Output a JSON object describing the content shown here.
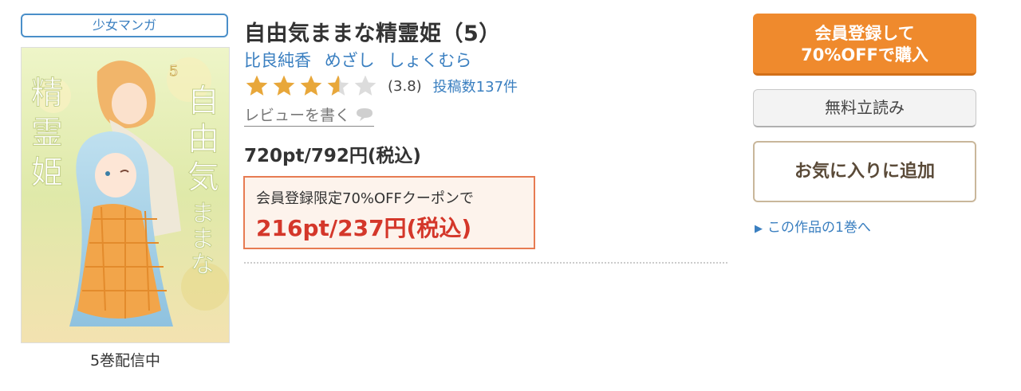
{
  "genre": "少女マンガ",
  "cover": {
    "alt": "自由気ままな精霊姫",
    "volume_mark": "5"
  },
  "volume_status": "5巻配信中",
  "title": "自由気ままな精霊姫（5）",
  "authors": [
    "比良純香",
    "めざし",
    "しょくむら"
  ],
  "rating": {
    "value": 3.8,
    "value_text": "(3.8)",
    "review_count_text": "投稿数137件"
  },
  "write_review": "レビューを書く",
  "price": "720pt/792円(税込)",
  "coupon": {
    "label": "会員登録限定70%OFFクーポンで",
    "price": "216pt/237円(税込)"
  },
  "buttons": {
    "buy_line1": "会員登録して",
    "buy_line2": "70%OFFで購入",
    "free_read": "無料立読み",
    "favorite": "お気に入りに追加"
  },
  "first_volume_link": "この作品の1巻へ",
  "colors": {
    "accent_blue": "#3a7fc0",
    "buy_orange": "#ef8a2d",
    "coupon_red": "#d4372a",
    "star_gold": "#e8a73a",
    "star_empty": "#dcdcdc"
  },
  "icons": {
    "star": "star-icon",
    "bubble": "speech-bubble-icon",
    "triangle": "triangle-right-icon"
  }
}
